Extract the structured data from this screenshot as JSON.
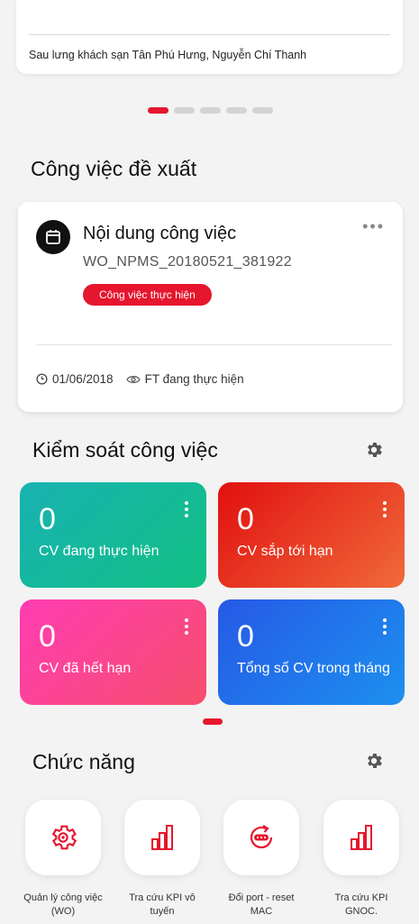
{
  "top_card": {
    "address": "Sau lưng khách sạn Tân Phú Hưng, Nguyễn Chí Thanh"
  },
  "carousel": {
    "active_index": 0,
    "count": 5
  },
  "suggested": {
    "title": "Công việc đề xuất",
    "card": {
      "title": "Nội dung công việc",
      "code": "WO_NPMS_20180521_381922",
      "tag": "Công việc thực hiện",
      "date": "01/06/2018",
      "status": "FT đang thực hiện"
    }
  },
  "control": {
    "title": "Kiểm soát công việc",
    "tiles": [
      {
        "value": "0",
        "label": "CV đang thực hiện"
      },
      {
        "value": "0",
        "label": "CV sắp tới hạn"
      },
      {
        "value": "0",
        "label": "CV đã hết hạn"
      },
      {
        "value": "0",
        "label": "Tổng số CV trong tháng"
      }
    ]
  },
  "features": {
    "title": "Chức năng",
    "items": [
      {
        "label": "Quản lý công việc (WO)",
        "icon": "settings-gear-icon"
      },
      {
        "label": "Tra cứu KPI vô tuyến",
        "icon": "bar-chart-icon"
      },
      {
        "label": "Đổi port - reset MAC",
        "icon": "port-reset-icon"
      },
      {
        "label": "Tra cứu KPI GNOC.",
        "icon": "bar-chart-icon"
      }
    ]
  },
  "colors": {
    "accent": "#e5162e",
    "tile_green": "#19b2b2",
    "tile_red": "#e11010",
    "tile_pink": "#ff3db3",
    "tile_blue": "#2659e6"
  }
}
